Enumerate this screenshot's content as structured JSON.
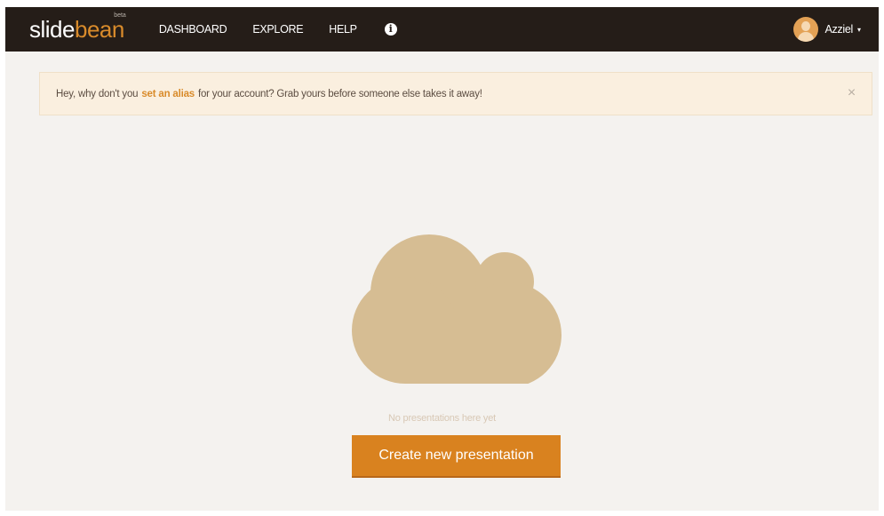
{
  "app": {
    "logo_part1": "slide",
    "logo_part2": "bean",
    "logo_badge": "beta"
  },
  "nav": {
    "links": [
      "DASHBOARD",
      "EXPLORE",
      "HELP"
    ],
    "info_icon": "info-circle-icon"
  },
  "user": {
    "name": "Azziel",
    "caret": "▾"
  },
  "alert": {
    "before": "Hey, why don't you",
    "link": "set an alias",
    "after": "for your account? Grab yours before someone else takes it away!",
    "close": "×"
  },
  "empty_state": {
    "icon": "cloud-icon",
    "message": "No presentations here yet",
    "button": "Create new presentation"
  },
  "colors": {
    "navbar": "#251d18",
    "accent": "#d9821f",
    "cloud": "#d6bd93",
    "alert_bg": "#faefdf",
    "page_bg": "#f4f2ef"
  }
}
